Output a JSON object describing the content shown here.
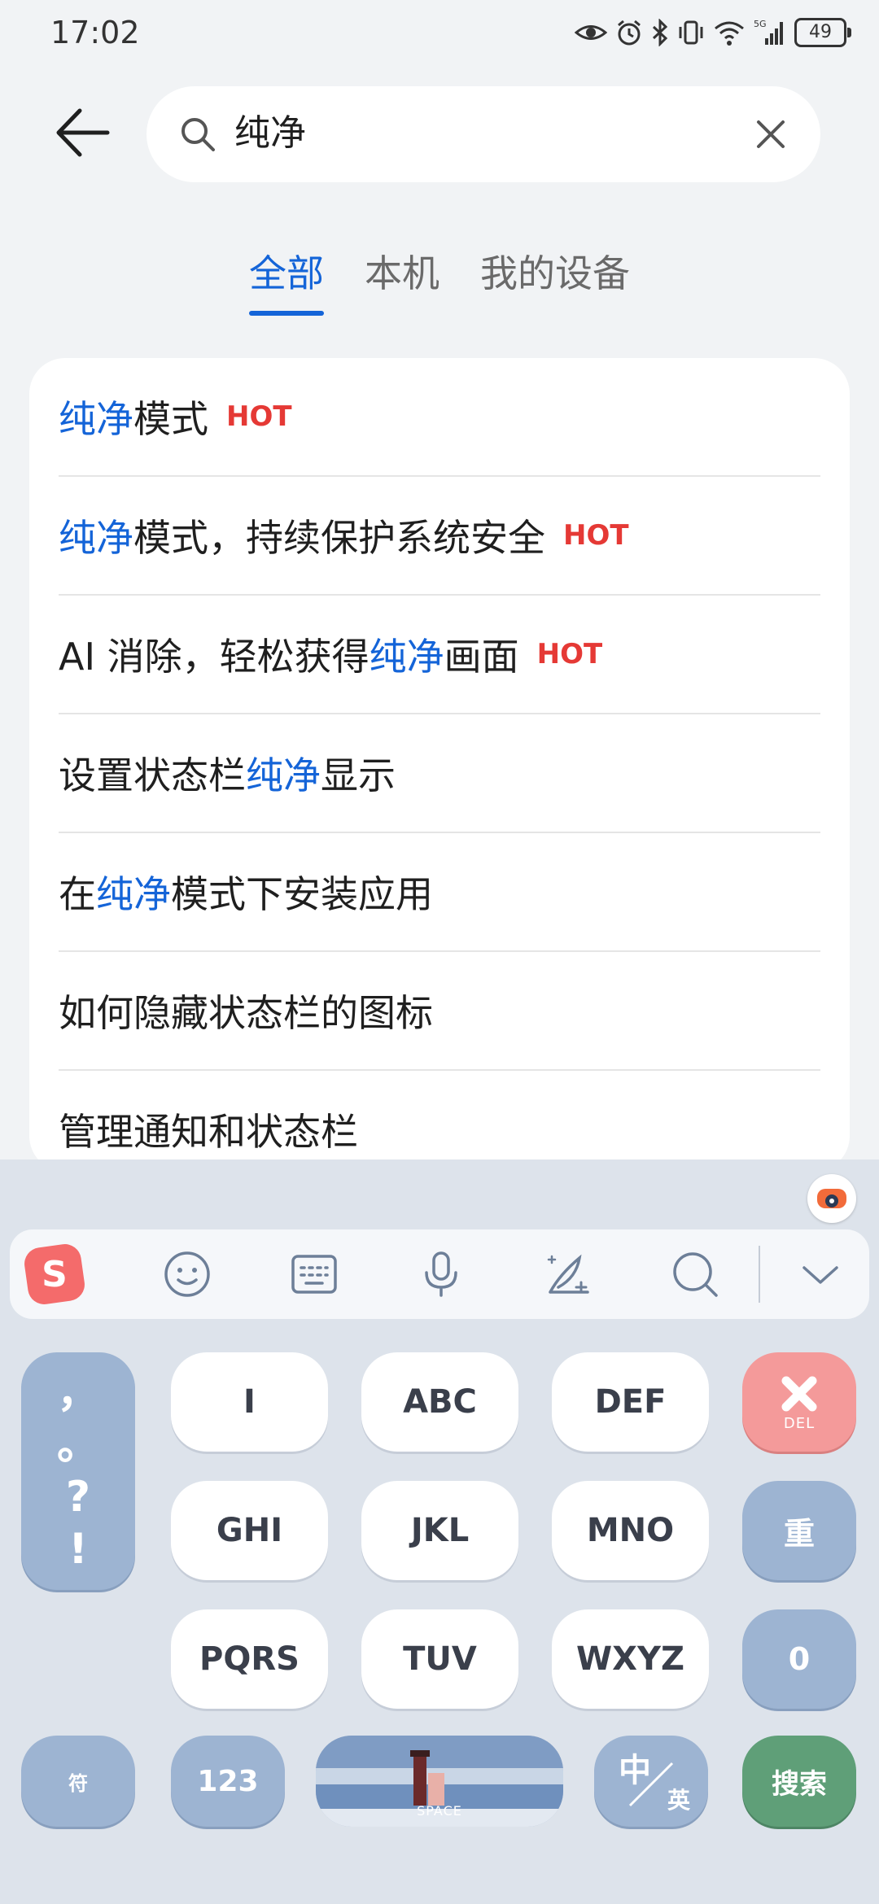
{
  "status_bar": {
    "time": "17:02",
    "battery": "49"
  },
  "search": {
    "query": "纯净"
  },
  "tabs": [
    {
      "label": "全部",
      "active": true
    },
    {
      "label": "本机",
      "active": false
    },
    {
      "label": "我的设备",
      "active": false
    }
  ],
  "results": [
    {
      "parts": [
        {
          "text": "纯净",
          "highlight": true
        },
        {
          "text": "模式",
          "highlight": false
        }
      ],
      "hot": "HOT"
    },
    {
      "parts": [
        {
          "text": "纯净",
          "highlight": true
        },
        {
          "text": "模式，持续保护系统安全",
          "highlight": false
        }
      ],
      "hot": "HOT"
    },
    {
      "parts": [
        {
          "text": "AI 消除，轻松获得",
          "highlight": false
        },
        {
          "text": "纯净",
          "highlight": true
        },
        {
          "text": "画面",
          "highlight": false
        }
      ],
      "hot": "HOT"
    },
    {
      "parts": [
        {
          "text": "设置状态栏",
          "highlight": false
        },
        {
          "text": "纯净",
          "highlight": true
        },
        {
          "text": "显示",
          "highlight": false
        }
      ],
      "hot": ""
    },
    {
      "parts": [
        {
          "text": "在",
          "highlight": false
        },
        {
          "text": "纯净",
          "highlight": true
        },
        {
          "text": "模式下安装应用",
          "highlight": false
        }
      ],
      "hot": ""
    },
    {
      "parts": [
        {
          "text": "如何隐藏状态栏的图标",
          "highlight": false
        }
      ],
      "hot": ""
    },
    {
      "parts": [
        {
          "text": "管理通知和状态栏",
          "highlight": false
        }
      ],
      "hot": ""
    }
  ],
  "keyboard": {
    "punctuation": [
      "，",
      "。",
      "?",
      "!"
    ],
    "keys": [
      "I",
      "ABC",
      "DEF",
      "GHI",
      "JKL",
      "MNO",
      "PQRS",
      "TUV",
      "WXYZ"
    ],
    "del_label": "DEL",
    "reinput_label": "重",
    "zero_label": "0",
    "symbol_label": "符",
    "num_label": "123",
    "space_label": "SPACE",
    "lang_cn": "中",
    "lang_en": "英",
    "search_label": "搜索"
  },
  "colors": {
    "accent": "#1464d8",
    "hot": "#e53935",
    "key_blue": "#9db4d2",
    "key_red": "#f49a9a",
    "key_green": "#5f9f78"
  },
  "icons": [
    "eye-icon",
    "alarm-icon",
    "bluetooth-icon",
    "vibrate-icon",
    "wifi-icon",
    "signal-icon",
    "battery-icon",
    "back-arrow-icon",
    "search-icon",
    "clear-icon",
    "sogou-logo-icon",
    "emoji-icon",
    "keyboard-icon",
    "microphone-icon",
    "handwriting-icon",
    "search-icon",
    "collapse-chevron-icon"
  ]
}
